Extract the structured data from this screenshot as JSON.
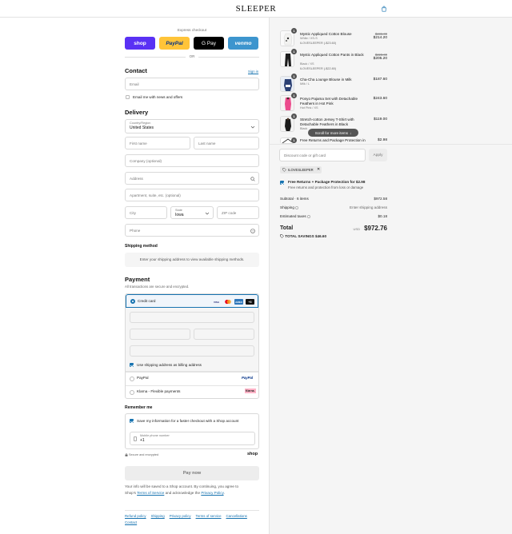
{
  "header": {
    "brand": "SLEEPER",
    "bag_icon": "shopping-bag-icon"
  },
  "express": {
    "label": "Express checkout",
    "buttons": [
      "shop",
      "PayPal",
      "G Pay",
      "venmo"
    ],
    "or": "OR"
  },
  "contact": {
    "heading": "Contact",
    "sign_in": "Sign in",
    "email_placeholder": "Email",
    "news_label": "Email me with news and offers"
  },
  "delivery": {
    "heading": "Delivery",
    "country_label": "Country/Region",
    "country_value": "United States",
    "first_name": "First name",
    "last_name": "Last name",
    "company": "Company (optional)",
    "address": "Address",
    "apartment": "Apartment, suite, etc. (optional)",
    "city": "City",
    "state_label": "State",
    "state_value": "Iowa",
    "zip": "ZIP code",
    "phone": "Phone"
  },
  "shipping": {
    "heading": "Shipping method",
    "note": "Enter your shipping address to view available shipping methods."
  },
  "payment": {
    "heading": "Payment",
    "subtitle": "All transactions are secure and encrypted.",
    "credit_card": "Credit card",
    "card_logos": [
      "VISA",
      "MC",
      "AMEX",
      "+3"
    ],
    "billing_label": "Use shipping address as billing address",
    "paypal_label": "PayPal",
    "paypal_logo": "PayPal",
    "klarna_label": "Klarna - Flexible payments",
    "klarna_logo": "Klarna."
  },
  "remember": {
    "heading": "Remember me",
    "save_label": "Save my information for a faster checkout with a Shop account",
    "mobile_label": "Mobile phone number",
    "mobile_value": "+1",
    "secure_note": "Secure and encrypted",
    "shop_logo": "shop"
  },
  "pay_now": "Pay now",
  "fine_print": {
    "line1": "Your info will be saved to a Shop account. By continuing, you agree to",
    "line2_prefix": "Shop's ",
    "terms": "Terms of Service",
    "line2_mid": " and acknowledge the ",
    "privacy": "Privacy Policy",
    "line2_end": "."
  },
  "footer": [
    "Refund policy",
    "Shipping",
    "Privacy policy",
    "Terms of service",
    "Cancellations",
    "Contact"
  ],
  "order": {
    "items": [
      {
        "qty": "1",
        "name": "Mystic Appliqued Cotton Blouse",
        "variant": "White / XS-S",
        "discount": "ILOVESLEEPER (-$23.60)",
        "old_price": "$236.00",
        "price": "$214.20"
      },
      {
        "qty": "1",
        "name": "Mystic Appliqued Cotton Pants in Black",
        "variant": "Black / XS",
        "discount": "ILOVESLEEPER (-$22.80)",
        "old_price": "$228.00",
        "price": "$205.20"
      },
      {
        "qty": "1",
        "name": "Cha-Cha Lounge Blouse in Milk",
        "variant": "Milk / L",
        "discount": "",
        "old_price": "",
        "price": "$187.60"
      },
      {
        "qty": "1",
        "name": "Ponyo Pajama Set with Detachable Feathers in Hot Pink",
        "variant": "Hot Pink / XS",
        "discount": "",
        "old_price": "",
        "price": "$243.60"
      },
      {
        "qty": "1",
        "name": "Stretch-cotton Jersey T-Shirt with Detachable Feathers in Black",
        "variant": "Black",
        "discount": "",
        "old_price": "",
        "price": "$119.00"
      },
      {
        "qty": "1",
        "name": "Free Returns and Package Protection in",
        "variant": "",
        "discount": "",
        "old_price": "",
        "price": "$2.98"
      }
    ],
    "scroll_hint": "Scroll for more items",
    "discount_placeholder": "Discount code or gift card",
    "apply": "Apply",
    "code_chip": "ILOVESLEEPER",
    "protection_title": "Free Returns + Package Protection for $2.98",
    "protection_sub": "Free returns and protection from loss or damage",
    "subtotal_label": "Subtotal · 6 items",
    "subtotal_value": "$972.58",
    "shipping_label": "Shipping",
    "shipping_value": "Enter shipping address",
    "taxes_label": "Estimated taxes",
    "taxes_value": "$0.18",
    "total_label": "Total",
    "currency": "USD",
    "total_value": "$972.76",
    "savings_label": "TOTAL SAVINGS",
    "savings_value": "$46.60"
  }
}
